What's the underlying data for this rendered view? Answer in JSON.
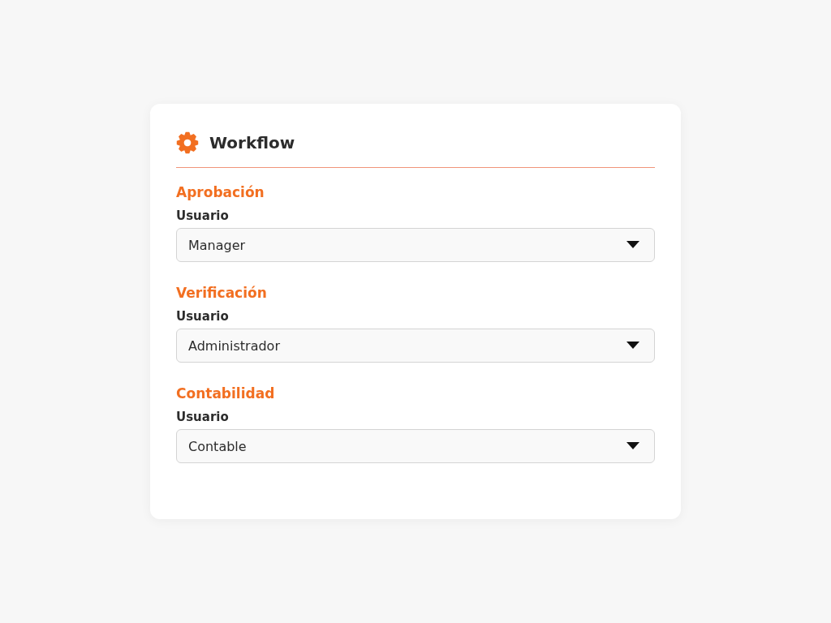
{
  "card": {
    "title": "Workflow"
  },
  "sections": [
    {
      "title": "Aprobación",
      "label": "Usuario",
      "value": "Manager"
    },
    {
      "title": "Verificación",
      "label": "Usuario",
      "value": "Administrador"
    },
    {
      "title": "Contabilidad",
      "label": "Usuario",
      "value": "Contable"
    }
  ]
}
